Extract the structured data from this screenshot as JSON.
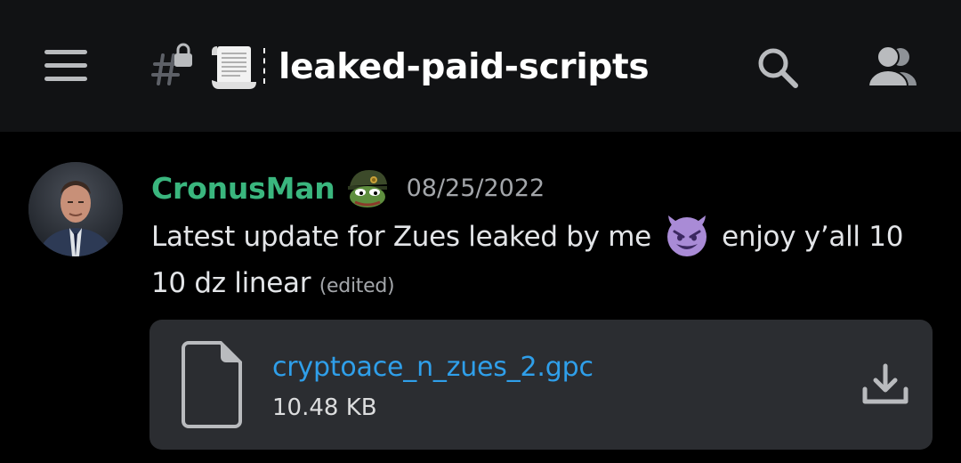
{
  "header": {
    "channel_name": "leaked-paid-scripts",
    "icons": {
      "menu": "hamburger-menu-icon",
      "channel": "locked-text-channel-icon",
      "emoji": "scroll-emoji-icon",
      "search": "search-icon",
      "members": "members-icon"
    }
  },
  "message": {
    "author": "CronusMan",
    "author_color": "#3ab67e",
    "timestamp": "08/25/2022",
    "content_part1": "Latest update for Zues leaked by me",
    "content_part2": "enjoy y’all 10 10 dz linear",
    "edited": "(edited)",
    "icons": {
      "role": "pepe-soldier-emoji-icon",
      "inline": "smiling-devil-emoji-icon"
    }
  },
  "attachment": {
    "file_name": "cryptoace_n_zues_2.gpc",
    "file_size": "10.48 KB",
    "icons": {
      "file": "file-icon",
      "download": "download-icon"
    }
  },
  "colors": {
    "header_bg": "#111214",
    "background": "#000000",
    "attachment_bg": "#2b2d31",
    "link": "#2f9fea"
  }
}
